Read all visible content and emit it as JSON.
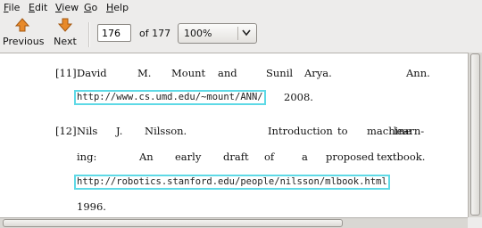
{
  "menu": {
    "file": {
      "mnemonic": "F",
      "rest": "ile"
    },
    "edit": {
      "mnemonic": "E",
      "rest": "dit"
    },
    "view": {
      "mnemonic": "V",
      "rest": "iew"
    },
    "go": {
      "mnemonic": "G",
      "rest": "o"
    },
    "help": {
      "mnemonic": "H",
      "rest": "elp"
    }
  },
  "toolbar": {
    "previous_label": "Previous",
    "next_label": "Next",
    "current_page": "176",
    "of_total": "of 177",
    "zoom": "100%"
  },
  "icons": {
    "previous": "arrow-up-icon",
    "next": "arrow-down-icon",
    "zoom_dropdown": "chevron-down-icon"
  },
  "colors": {
    "arrow": "#e88a2a",
    "link_highlight": "#5ed9e6"
  },
  "document": {
    "ref11": {
      "num": "[11]",
      "words": [
        "David",
        "M.",
        "Mount",
        "and",
        "Sunil",
        "Arya.",
        "Ann."
      ],
      "url": "http://www.cs.umd.edu/~mount/ANN/",
      "year": "2008."
    },
    "ref12": {
      "num": "[12]",
      "line1": [
        "Nils",
        "J.",
        "Nilsson.",
        "Introduction",
        "to",
        "machine",
        "learn-"
      ],
      "line2": [
        "ing:",
        "An",
        "early",
        "draft",
        "of",
        "a",
        "proposed",
        "textbook."
      ],
      "url": "http://robotics.stanford.edu/people/nilsson/mlbook.html",
      "year": "1996."
    }
  }
}
